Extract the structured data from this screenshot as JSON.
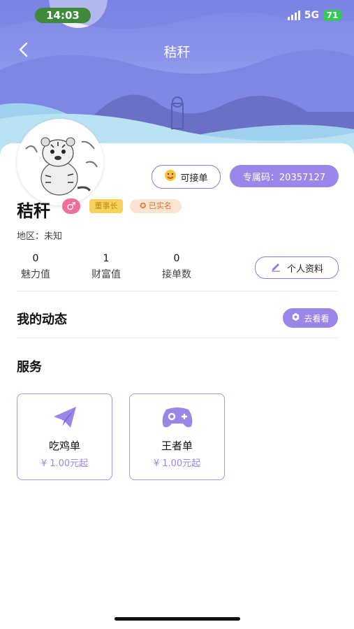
{
  "status_bar": {
    "time": "14:03",
    "network": "5G",
    "battery": "71"
  },
  "nav": {
    "title": "秸秆"
  },
  "profile": {
    "name": "秸秆",
    "gender_symbol": "♂",
    "badges": [
      "董事长",
      "已实名"
    ],
    "region": "地区：未知",
    "accept_order_label": "可接单",
    "exclusive_code_label": "专属码：20357127",
    "stats": [
      {
        "value": "0",
        "label": "魅力值"
      },
      {
        "value": "1",
        "label": "财富值"
      },
      {
        "value": "0",
        "label": "接单数"
      }
    ],
    "profile_button": "个人资料"
  },
  "dynamics": {
    "title": "我的动态",
    "button": "去看看"
  },
  "services": {
    "title": "服务",
    "items": [
      {
        "name": "吃鸡单",
        "price": "¥ 1.00元起",
        "icon": "paper-plane-icon"
      },
      {
        "name": "王者单",
        "price": "¥ 1.00元起",
        "icon": "gamepad-icon"
      }
    ]
  },
  "colors": {
    "accent": "#9b86ea",
    "gender": "#f06f9a",
    "chairman_badge": "#f6d25c",
    "verified_badge": "#fbe4d2"
  }
}
